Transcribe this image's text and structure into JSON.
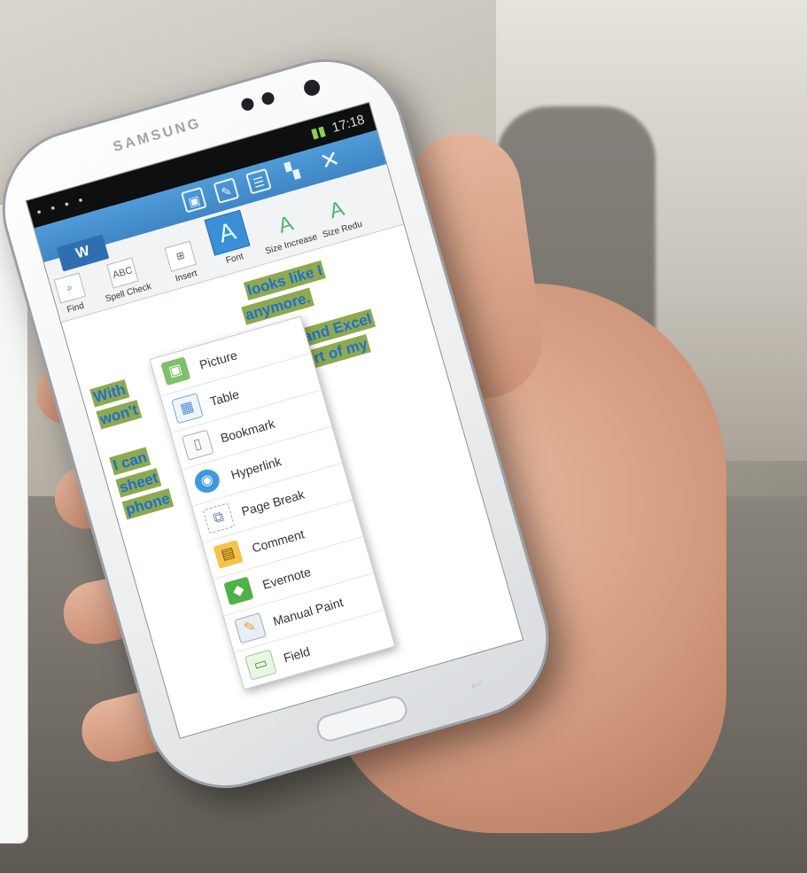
{
  "phone": {
    "brand": "SAMSUNG",
    "status": {
      "time": "17:18",
      "left_icons": "▪ ▪ ▪ ▪"
    }
  },
  "toolbar": {
    "save_icon": "save-icon",
    "edit_icon": "edit-icon",
    "list_icon": "list-icon",
    "grid_icon": "grid-icon",
    "close_glyph": "✕"
  },
  "ribbon": {
    "app_badge": "W",
    "items": [
      {
        "label": "Find",
        "icon": "search-icon"
      },
      {
        "label": "Spell Check",
        "icon_text": "ABC"
      },
      {
        "label": "Insert",
        "icon": "insert-icon"
      },
      {
        "label": "Font",
        "icon_text": "A"
      },
      {
        "label": "Size Increase",
        "icon_text": "A"
      },
      {
        "label": "Size Redu",
        "icon_text": "A"
      }
    ]
  },
  "document": {
    "lines": [
      "looks like I",
      "anymore.",
      "With",
      "point and Excel",
      "won't",
      "comfort of my",
      "I can",
      "sheet",
      "phone"
    ]
  },
  "insert_menu": {
    "items": [
      {
        "label": "Picture",
        "icon": "picture-icon",
        "glyph": "▣"
      },
      {
        "label": "Table",
        "icon": "table-icon",
        "glyph": "▦"
      },
      {
        "label": "Bookmark",
        "icon": "bookmark-icon",
        "glyph": "▯"
      },
      {
        "label": "Hyperlink",
        "icon": "globe-icon",
        "glyph": "◉"
      },
      {
        "label": "Page Break",
        "icon": "page-break-icon",
        "glyph": "⧉"
      },
      {
        "label": "Comment",
        "icon": "comment-icon",
        "glyph": "▤"
      },
      {
        "label": "Evernote",
        "icon": "evernote-icon",
        "glyph": "◆"
      },
      {
        "label": "Manual Paint",
        "icon": "paint-icon",
        "glyph": "✎"
      },
      {
        "label": "Field",
        "icon": "field-icon",
        "glyph": "▭"
      }
    ]
  },
  "colors": {
    "toolbar": "#3f86c4",
    "highlight": "#8ea94f",
    "text": "#1f6fd0"
  }
}
